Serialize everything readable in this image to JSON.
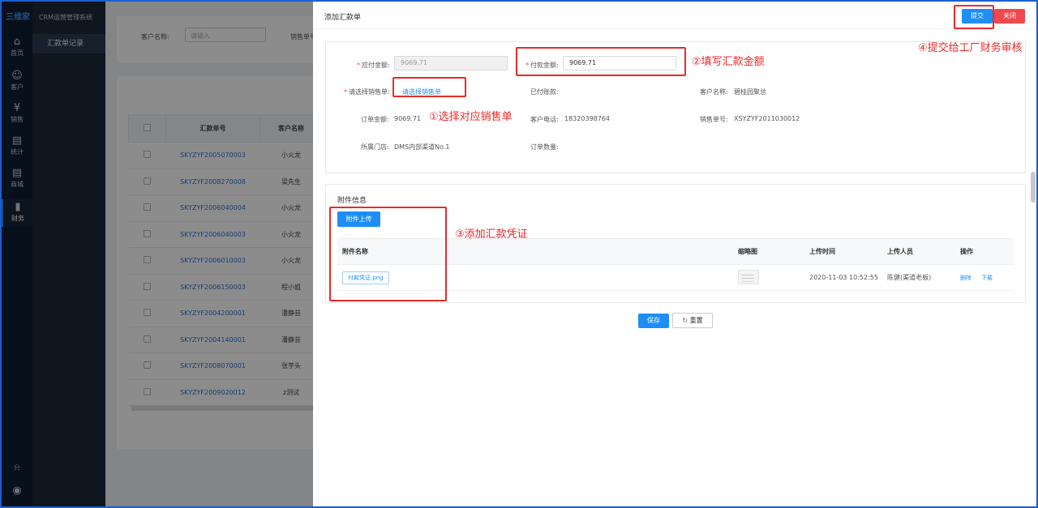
{
  "app": {
    "logo": "三维家",
    "system_name": "CRM运营管理系统"
  },
  "nav": {
    "items": [
      {
        "label": "首页",
        "icon": "home-icon",
        "glyph": "⌂"
      },
      {
        "label": "客户",
        "icon": "users-icon",
        "glyph": "☺"
      },
      {
        "label": "销售",
        "icon": "yen-icon",
        "glyph": "¥"
      },
      {
        "label": "统计",
        "icon": "stats-doc-icon",
        "glyph": "▤"
      },
      {
        "label": "商城",
        "icon": "mall-doc-icon",
        "glyph": "▤"
      },
      {
        "label": "财务",
        "icon": "finance-chart-icon",
        "glyph": "▮"
      }
    ],
    "bottom": [
      {
        "icon": "bell-icon",
        "glyph": "⍾"
      },
      {
        "icon": "user-avatar-icon",
        "glyph": "◉"
      }
    ]
  },
  "submenu": {
    "active": "汇款单记录"
  },
  "list_page": {
    "filter": {
      "customer_label": "客户名称:",
      "customer_placeholder": "请输入",
      "sales_label": "销售单号:"
    },
    "columns": [
      "汇款单号",
      "客户名称"
    ],
    "rows": [
      {
        "no": "SKYZYF2005070003",
        "customer": "小火龙"
      },
      {
        "no": "SKYZYF2008270008",
        "customer": "梁先生"
      },
      {
        "no": "SKYZYF2006040004",
        "customer": "小火龙"
      },
      {
        "no": "SKYZYF2006040003",
        "customer": "小火龙"
      },
      {
        "no": "SKYZYF2006010003",
        "customer": "小火龙"
      },
      {
        "no": "SKYZYF2006150003",
        "customer": "程小姐"
      },
      {
        "no": "SKYZYF2004200001",
        "customer": "潘静芸"
      },
      {
        "no": "SKYZYF2004140001",
        "customer": "潘静芸"
      },
      {
        "no": "SKYZYF2008070001",
        "customer": "张芋头"
      },
      {
        "no": "SKYZYF2009020012",
        "customer": "z测试"
      }
    ]
  },
  "drawer": {
    "title": "添加汇款单",
    "submit_label": "提交",
    "close_label": "关闭",
    "form": {
      "payable_label": "应付金额:",
      "payable_value": "9069.71",
      "payment_label": "付款金额:",
      "payment_value": "9069.71",
      "select_order_label": "请选择销售单:",
      "select_order_link": "请选择销售单",
      "paid_label": "已付账款:",
      "paid_value": "",
      "customer_label": "客户名称:",
      "customer_value": "碧桂园聚总",
      "order_amount_label": "订单金额:",
      "order_amount_value": "9069.71",
      "phone_label": "客户电话:",
      "phone_value": "18320398764",
      "sales_no_label": "销售单号:",
      "sales_no_value": "XSYZYF2011030012",
      "store_label": "所属门店:",
      "store_value": "DMS内部渠道No.1",
      "order_qty_label": "订单数量:",
      "order_qty_value": ""
    },
    "attachments": {
      "section_title": "附件信息",
      "upload_label": "附件上传",
      "columns": [
        "附件名称",
        "缩略图",
        "上传时间",
        "上传人员",
        "操作"
      ],
      "rows": [
        {
          "name": "付款凭证.png",
          "time": "2020-11-03 10:52:55",
          "uploader": "陈健(渠道老板)",
          "delete": "删除",
          "download": "下载"
        }
      ]
    },
    "save_label": "保存",
    "reset_label": "重置"
  },
  "annotations": {
    "step1": "①选择对应销售单",
    "step2": "②填写汇款金额",
    "step3": "③添加汇款凭证",
    "step4": "④提交给工厂财务审核"
  },
  "colors": {
    "primary": "#1d8ef7",
    "danger": "#f0484c",
    "annotation": "#ea2a2a",
    "nav_bg": "#0f1e33"
  }
}
